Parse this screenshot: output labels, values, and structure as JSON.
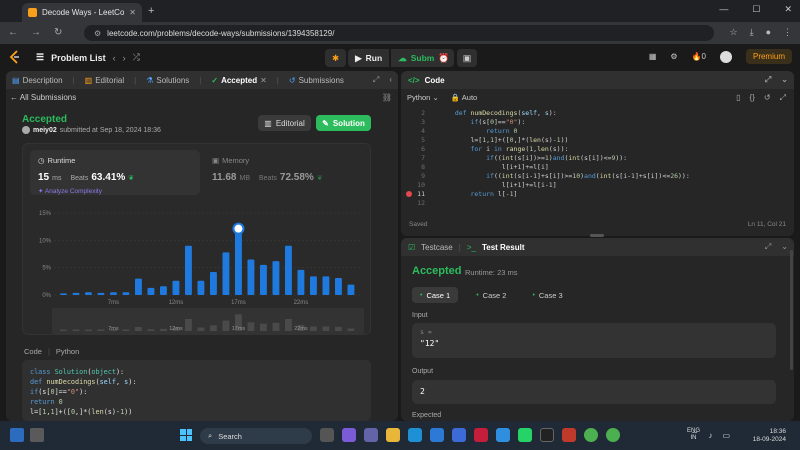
{
  "browser": {
    "tab_title": "Decode Ways - LeetCode",
    "url_icon": "page-info-icon",
    "url": "leetcode.com/problems/decode-ways/submissions/1394358129/"
  },
  "header": {
    "problem_list": "Problem List",
    "run": "Run",
    "submit": "Submit",
    "streak": "0",
    "premium": "Premium"
  },
  "left_tabs": {
    "description": "Description",
    "editorial": "Editorial",
    "solutions": "Solutions",
    "accepted": "Accepted",
    "submissions": "Submissions"
  },
  "submission": {
    "all_submissions": "All Submissions",
    "status": "Accepted",
    "user": "meiy02",
    "submitted_at": "submitted at Sep 18, 2024 18:36",
    "editorial_btn": "Editorial",
    "solution_btn": "Solution",
    "runtime_label": "Runtime",
    "runtime_value": "15",
    "runtime_unit": "ms",
    "beats_label": "Beats",
    "runtime_beats": "63.41%",
    "analyze": "Analyze Complexity",
    "memory_label": "Memory",
    "memory_value": "11.68",
    "memory_unit": "MB",
    "memory_beats": "72.58%"
  },
  "chart_data": {
    "type": "bar",
    "title": "",
    "xlabel": "",
    "ylabel": "",
    "ylim": [
      0,
      15
    ],
    "yticks": [
      "15%",
      "10%",
      "5%",
      "0%"
    ],
    "xticks": [
      "7ms",
      "12ms",
      "17ms",
      "22ms"
    ],
    "mini_xticks": [
      "7ms",
      "12ms",
      "17ms",
      "22ms"
    ],
    "values": [
      0.3,
      0.4,
      0.5,
      0.4,
      0.5,
      0.5,
      3.0,
      1.3,
      1.6,
      2.6,
      9.0,
      2.6,
      4.2,
      7.8,
      12.5,
      6.5,
      5.5,
      6.2,
      9.0,
      4.6,
      3.4,
      3.4,
      3.1,
      1.9
    ],
    "highlight_index": 14,
    "bar_color": "#1f7ae0"
  },
  "code_panel": {
    "label": "Code",
    "lang": "Python",
    "lines": [
      "class Solution(object):",
      "    def numDecodings(self, s):",
      "        if(s[0]==\"0\"):",
      "            return 0",
      "        l=[1,1]+([0,]*(len(s)-1))"
    ]
  },
  "editor": {
    "tab": "Code",
    "lang": "Python",
    "mode": "Auto",
    "saved": "Saved",
    "cursor": "Ln 11, Col 21",
    "line_numbers": [
      "2",
      "3",
      "4",
      "5",
      "6",
      "7",
      "8",
      "9",
      "10",
      "11",
      "12"
    ]
  },
  "testpanel": {
    "testcase_tab": "Testcase",
    "result_tab": "Test Result",
    "status": "Accepted",
    "runtime": "Runtime: 23 ms",
    "cases": [
      "Case 1",
      "Case 2",
      "Case 3"
    ],
    "input_label": "Input",
    "input_var": "s =",
    "input_value": "\"12\"",
    "output_label": "Output",
    "output_value": "2",
    "expected_label": "Expected"
  },
  "taskbar": {
    "search": "Search",
    "lang1": "ENG",
    "lang2": "IN",
    "time": "18:36",
    "date": "18-09-2024",
    "notif": "1"
  }
}
